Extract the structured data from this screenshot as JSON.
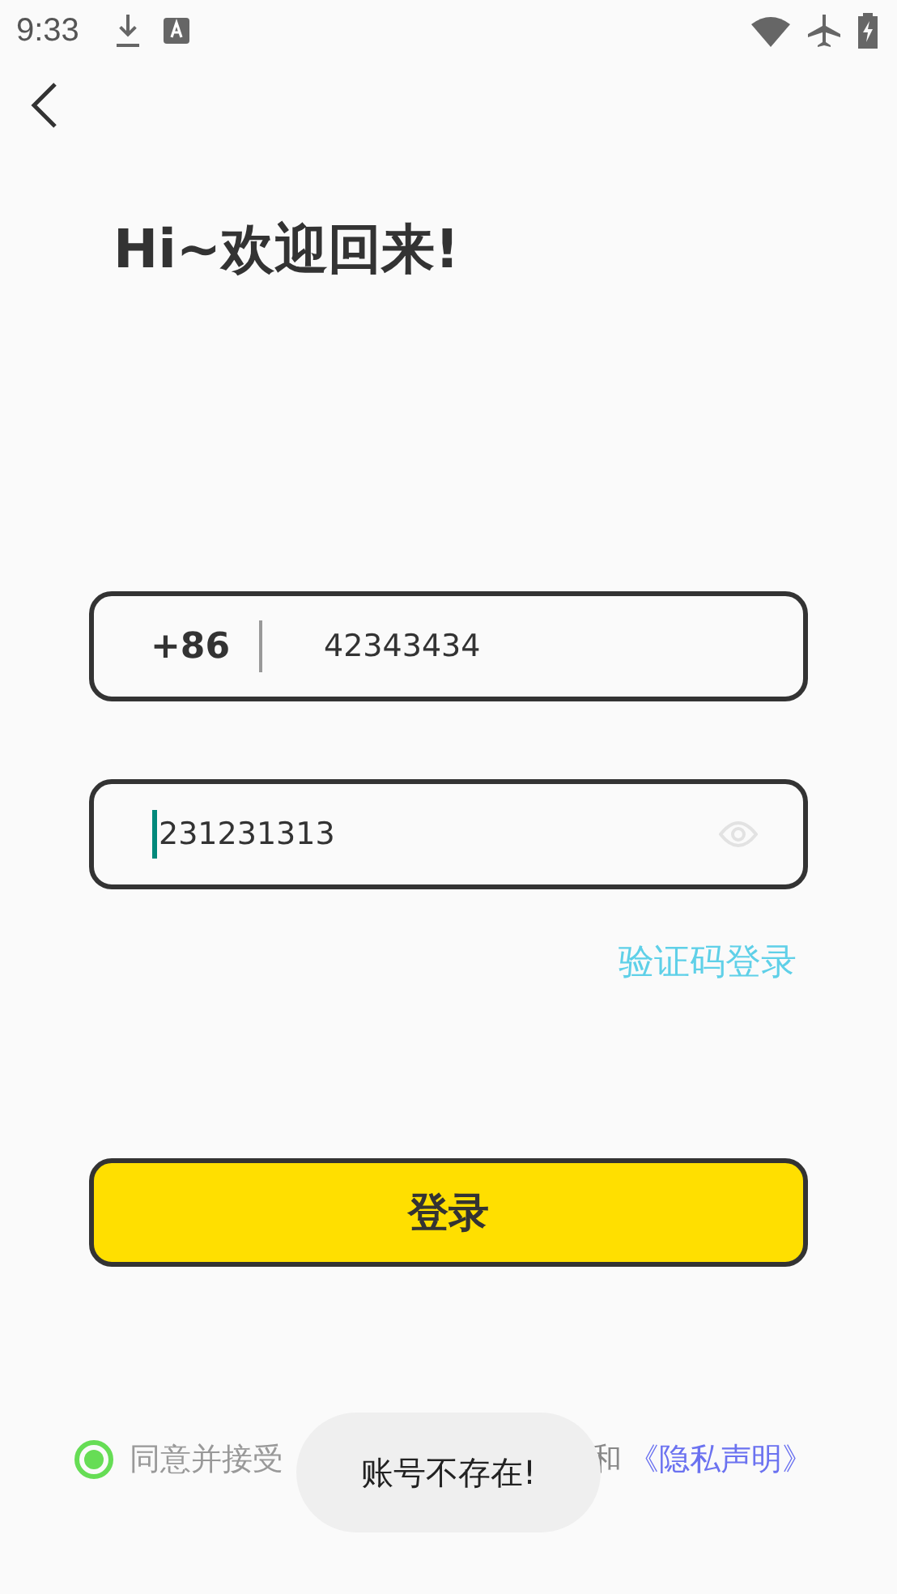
{
  "status_bar": {
    "time": "9:33"
  },
  "title": "Hi~欢迎回来!",
  "phone_field": {
    "country_code": "+86",
    "value": "42343434"
  },
  "password_field": {
    "value": "231231313",
    "focused": true
  },
  "alt_login_link": "验证码登录",
  "login_button": "登录",
  "agreement": {
    "checked": true,
    "prefix": "同意并接受",
    "connector": "和",
    "link": "《隐私声明》"
  },
  "toast": "账号不存在!"
}
